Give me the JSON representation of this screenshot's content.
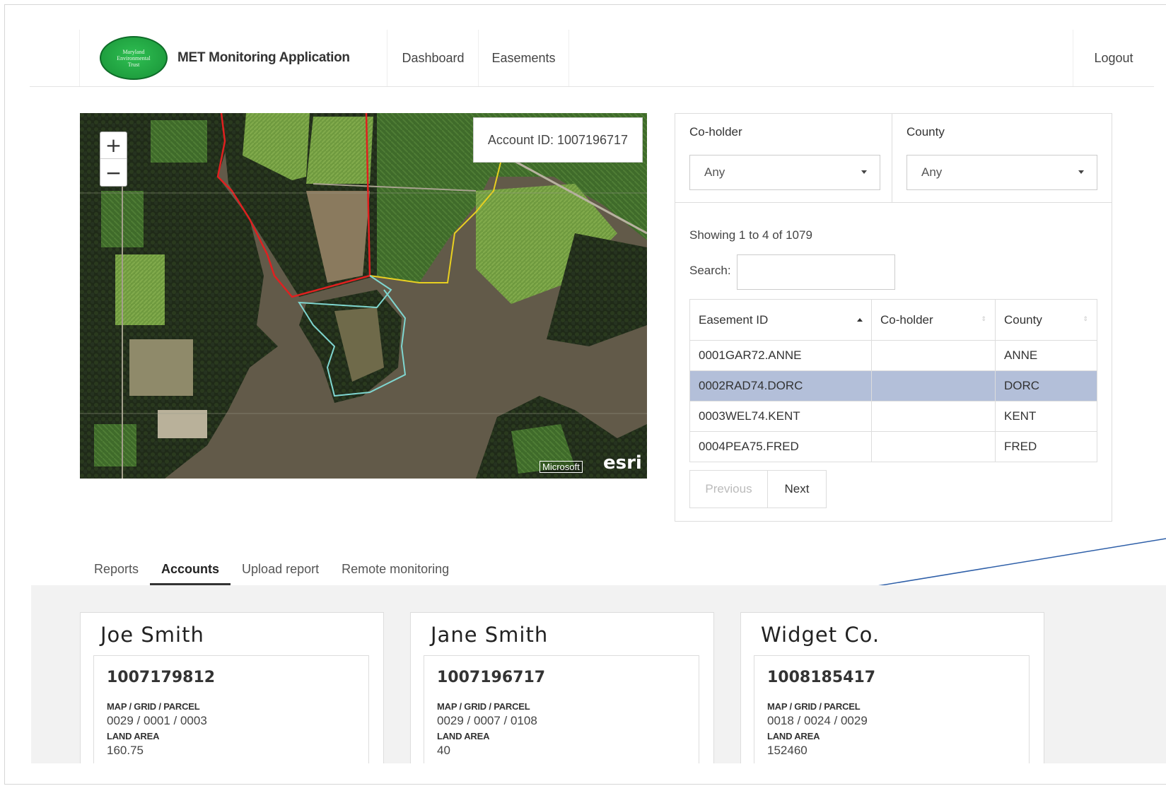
{
  "app": {
    "logo_text": [
      "Maryland",
      "Environmental",
      "Trust"
    ],
    "title": "MET Monitoring Application"
  },
  "nav": {
    "dashboard": "Dashboard",
    "easements": "Easements",
    "logout": "Logout"
  },
  "map": {
    "zoom_in": "+",
    "zoom_out": "−",
    "popup": "Account ID: 1007196717",
    "attribution_ms": "Microsoft",
    "attribution_esri": "esri"
  },
  "filters": {
    "coholder_label": "Co-holder",
    "coholder_value": "Any",
    "county_label": "County",
    "county_value": "Any"
  },
  "table": {
    "showing": "Showing 1 to 4 of 1079",
    "search_label": "Search:",
    "search_value": "",
    "headers": [
      "Easement ID",
      "Co-holder",
      "County"
    ],
    "rows": [
      {
        "id": "0001GAR72.ANNE",
        "coholder": "",
        "county": "ANNE"
      },
      {
        "id": "0002RAD74.DORC",
        "coholder": "",
        "county": "DORC"
      },
      {
        "id": "0003WEL74.KENT",
        "coholder": "",
        "county": "KENT"
      },
      {
        "id": "0004PEA75.FRED",
        "coholder": "",
        "county": "FRED"
      }
    ],
    "selected_row": 1,
    "prev": "Previous",
    "next": "Next"
  },
  "tabs": [
    "Reports",
    "Accounts",
    "Upload report",
    "Remote monitoring"
  ],
  "active_tab": "Accounts",
  "accounts": [
    {
      "name": "Joe Smith",
      "id": "1007179812",
      "mgp_label": "MAP / GRID / PARCEL",
      "mgp": "0029 / 0001 / 0003",
      "area_label": "LAND AREA",
      "area": "160.75"
    },
    {
      "name": "Jane Smith",
      "id": "1007196717",
      "mgp_label": "MAP / GRID / PARCEL",
      "mgp": "0029 / 0007 / 0108",
      "area_label": "LAND AREA",
      "area": "40"
    },
    {
      "name": "Widget Co.",
      "id": "1008185417",
      "mgp_label": "MAP / GRID / PARCEL",
      "mgp": "0018 / 0024 / 0029",
      "area_label": "LAND AREA",
      "area": "152460"
    }
  ],
  "colors": {
    "selected_row": "#b3bfd9",
    "logo_green": "#1f9f3f",
    "boundary_red": "#e02020",
    "boundary_yellow": "#e8d020",
    "boundary_teal": "#7fd6d0",
    "annotation_line": "#2e5fa8"
  }
}
